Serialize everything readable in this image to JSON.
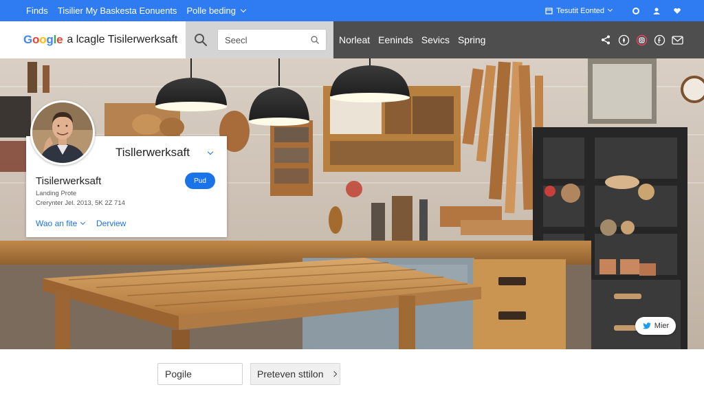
{
  "topbar": {
    "items": [
      "Finds",
      "Tisilier My Baskesta Eonuents",
      "Polle beding"
    ],
    "account_label": "Tesutit Eonted"
  },
  "header": {
    "brand_logo": "Google",
    "brand_text": "a lcagle Tisilerwerksaft",
    "search_placeholder": "Seecl",
    "nav": [
      "Norleat",
      "Eeninds",
      "Sevics",
      "Spring"
    ]
  },
  "profile": {
    "title": "Tisllerwerksaft",
    "name": "Tisilerwerksaft",
    "subtitle_1": "Landing Prote",
    "subtitle_2": "Crerynter Jel. 2013, 5K 2Z 714",
    "button_label": "Pud",
    "link_1": "Wao an fite",
    "link_2": "Derview"
  },
  "social": {
    "twitter_label": "Mier"
  },
  "bottom": {
    "input_value": "Pogile",
    "button_label": "Preteven sttilon"
  },
  "colors": {
    "topbar": "#2f7cf2",
    "accent": "#1a73e8",
    "nav_bg": "#4e4e4e",
    "search_bg": "#d4d4d4"
  }
}
